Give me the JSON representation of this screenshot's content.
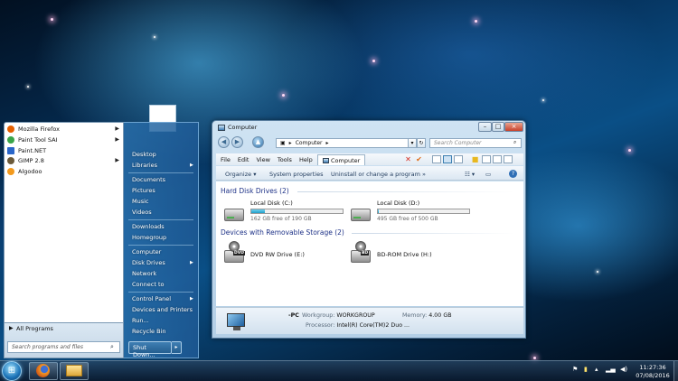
{
  "start_menu": {
    "programs": [
      {
        "label": "Mozilla Firefox",
        "has_arrow": true,
        "color": "#e66000"
      },
      {
        "label": "Paint Tool SAI",
        "has_arrow": true,
        "color": "#3aa548"
      },
      {
        "label": "Paint.NET",
        "has_arrow": false,
        "color": "#2a66c9"
      },
      {
        "label": "GIMP 2.8",
        "has_arrow": true,
        "color": "#6b5a3a"
      },
      {
        "label": "Algodoo",
        "has_arrow": false,
        "color": "#f39a1d"
      }
    ],
    "all_programs": "All Programs",
    "search_placeholder": "Search programs and files",
    "right_items": {
      "desktop": "Desktop",
      "libraries": "Libraries",
      "documents": "Documents",
      "pictures": "Pictures",
      "music": "Music",
      "videos": "Videos",
      "downloads": "Downloads",
      "homegroup": "Homegroup",
      "computer": "Computer",
      "disk_drives": "Disk Drives",
      "network": "Network",
      "connect_to": "Connect to",
      "control_panel": "Control Panel",
      "devices_printers": "Devices and Printers",
      "run": "Run...",
      "recycle_bin": "Recycle Bin"
    },
    "shutdown": "Shut Down..."
  },
  "explorer": {
    "title": "Computer",
    "address": "Computer",
    "search_placeholder": "Search Computer",
    "menu": [
      "File",
      "Edit",
      "View",
      "Tools",
      "Help"
    ],
    "active_tab": "Computer",
    "commands": {
      "organize": "Organize",
      "system_properties": "System properties",
      "uninstall": "Uninstall or change a program",
      "more": "»"
    },
    "groups": {
      "hdd": "Hard Disk Drives (2)",
      "removable": "Devices with Removable Storage (2)"
    },
    "drives": {
      "c": {
        "name": "Local Disk (C:)",
        "free": "162 GB free of 190 GB",
        "used_fraction": 0.15
      },
      "d": {
        "name": "Local Disk (D:)",
        "free": "495 GB free of 500 GB",
        "used_fraction": 0.01
      },
      "e": {
        "name": "DVD RW Drive (E:)",
        "badge": "DVD"
      },
      "h": {
        "name": "BD-ROM Drive (H:)",
        "badge": "BD"
      }
    },
    "details": {
      "pc_name": "-PC",
      "workgroup_label": "Workgroup:",
      "workgroup": "WORKGROUP",
      "memory_label": "Memory:",
      "memory": "4.00 GB",
      "processor_label": "Processor:",
      "processor": "Intel(R) Core(TM)2 Duo ..."
    }
  },
  "taskbar": {
    "clock_time": "11:27:36",
    "clock_date": "07/08/2016"
  }
}
